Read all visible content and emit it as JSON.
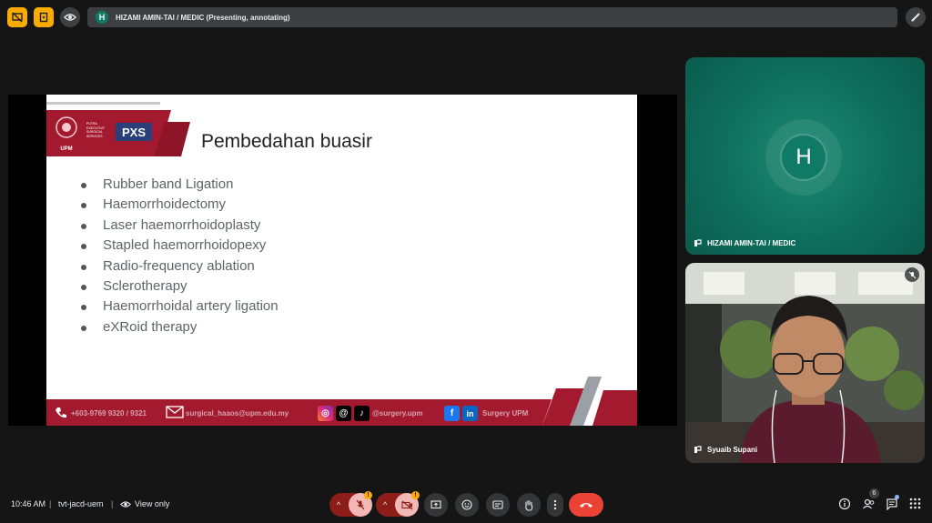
{
  "top_bar": {
    "presenter_initial": "H",
    "presenter_title": "HIZAMI AMIN-TAI / MEDIC (Presenting, annotating)"
  },
  "slide": {
    "title": "Pembedahan buasir",
    "bullets": [
      "Rubber band Ligation",
      "Haemorrhoidectomy",
      "Laser haemorrhoidoplasty",
      "Stapled haemorrhoidopexy",
      "Radio-frequency ablation",
      "Sclerotherapy",
      "Haemorrhoidal artery ligation",
      "eXRoid therapy"
    ],
    "logo_upm": "UPM",
    "logo_pxs": "PXS",
    "logo_putra_text": "PUTRA EXECUTIVE SURGICAL SERVICES",
    "footer": {
      "phone": "+603-9769 9320 / 9321",
      "email": "surgical_haaos@upm.edu.my",
      "handle": "@surgery.upm",
      "facebook": "Surgery UPM"
    }
  },
  "tiles": {
    "presenter": {
      "initial": "H",
      "name": "HIZAMI AMIN-TAI / MEDIC"
    },
    "participant": {
      "name": "Syuaib Supani"
    }
  },
  "bottom_bar": {
    "time": "10:46 AM",
    "meeting_code": "tvt-jacd-uem",
    "view_mode": "View only",
    "people_count": "6",
    "mic_badge": "!",
    "cam_badge": "!"
  },
  "colors": {
    "accent_red": "#ea4335",
    "brand_maroon": "#a3192e",
    "tile_green": "#0e6e5c",
    "warning": "#f9ab00"
  }
}
